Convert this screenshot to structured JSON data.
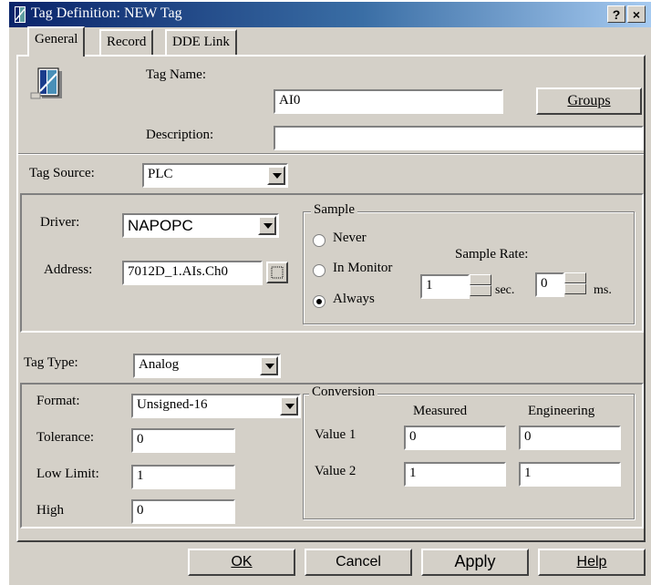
{
  "window": {
    "title": "Tag Definition: NEW Tag",
    "help_button": "?",
    "close_button": "×"
  },
  "tabs": [
    {
      "label": "General",
      "active": true
    },
    {
      "label": "Record",
      "active": false
    },
    {
      "label": "DDE Link",
      "active": false
    }
  ],
  "general": {
    "tag_name_label": "Tag Name:",
    "tag_name_value": "AI0",
    "description_label": "Description:",
    "description_value": "",
    "groups_button": "Groups",
    "tag_source_label": "Tag Source:",
    "tag_source_value": "PLC"
  },
  "driver_section": {
    "driver_label": "Driver:",
    "driver_value": "NAPOPC",
    "address_label": "Address:",
    "address_value": "7012D_1.AIs.Ch0",
    "browse_icon": "ellipsis-icon"
  },
  "sample": {
    "title": "Sample",
    "options": [
      {
        "label": "Never",
        "checked": false
      },
      {
        "label": "In Monitor",
        "checked": false
      },
      {
        "label": "Always",
        "checked": true
      }
    ],
    "rate_label": "Sample Rate:",
    "seconds_value": "1",
    "seconds_unit": "sec.",
    "ms_value": "0",
    "ms_unit": "ms."
  },
  "tag_type": {
    "label": "Tag Type:",
    "value": "Analog"
  },
  "analog": {
    "format_label": "Format:",
    "format_value": "Unsigned-16",
    "tolerance_label": "Tolerance:",
    "tolerance_value": "0",
    "low_limit_label": "Low Limit:",
    "low_limit_value": "1",
    "high_label": "High",
    "high_value": "0"
  },
  "conversion": {
    "title": "Conversion",
    "measured_header": "Measured",
    "engineering_header": "Engineering",
    "rows": [
      {
        "label": "Value 1",
        "measured": "0",
        "engineering": "0"
      },
      {
        "label": "Value 2",
        "measured": "1",
        "engineering": "1"
      }
    ]
  },
  "buttons": {
    "ok": "OK",
    "cancel": "Cancel",
    "apply": "Apply",
    "help": "Help"
  },
  "colors": {
    "face": "#d4d0c8",
    "titlebar_start": "#0a246a",
    "titlebar_end": "#a6caf0"
  }
}
